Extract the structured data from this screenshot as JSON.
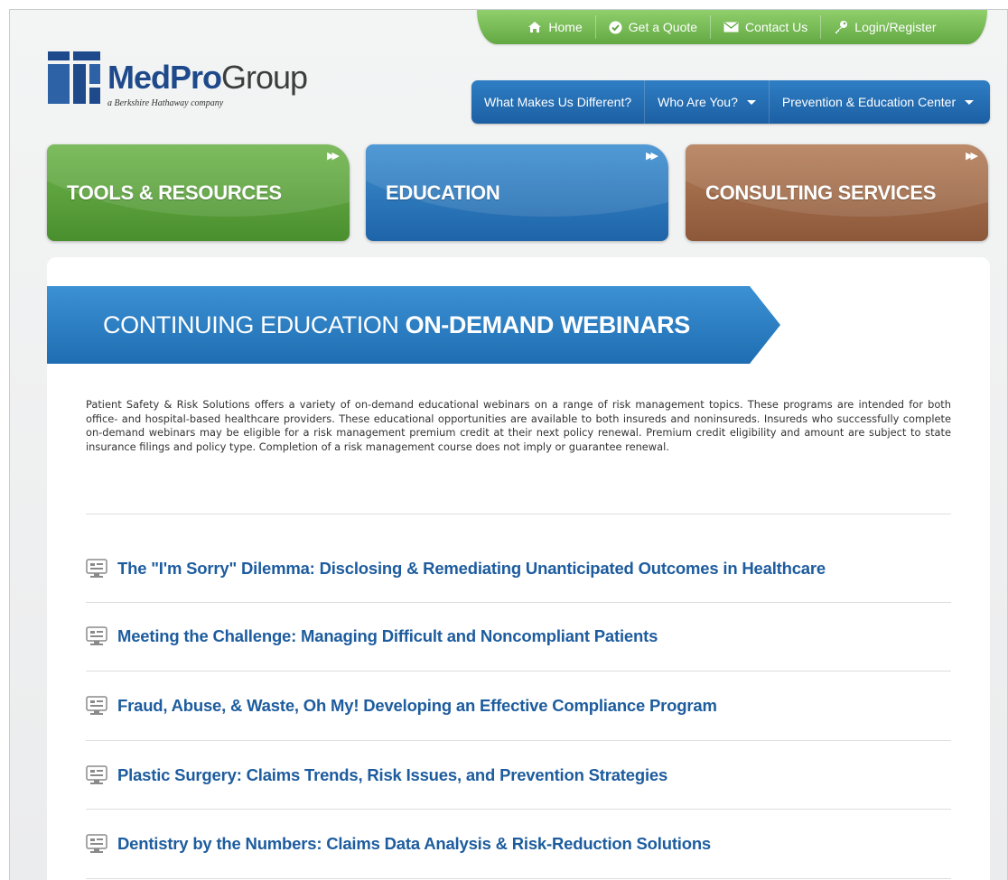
{
  "utility_nav": [
    {
      "label": "Home",
      "icon": "home-icon"
    },
    {
      "label": "Get a Quote",
      "icon": "check-circle-icon"
    },
    {
      "label": "Contact Us",
      "icon": "envelope-icon"
    },
    {
      "label": "Login/Register",
      "icon": "key-icon"
    }
  ],
  "logo": {
    "word_bold": "MedPro",
    "word_light": "Group",
    "tagline": "a Berkshire Hathaway company"
  },
  "main_nav": [
    {
      "label": "What Makes Us Different?"
    },
    {
      "label": "Who Are You?",
      "has_dropdown": true
    },
    {
      "label": "Prevention & Education Center",
      "has_dropdown": true
    }
  ],
  "tiles": [
    {
      "label": "TOOLS & RESOURCES",
      "color": "#5c9f3c"
    },
    {
      "label": "EDUCATION",
      "color": "#2a78bd"
    },
    {
      "label": "CONSULTING SERVICES",
      "color": "#9e6946"
    }
  ],
  "banner": {
    "light": "CONTINUING EDUCATION",
    "bold": "ON-DEMAND WEBINARS"
  },
  "intro": "Patient Safety & Risk Solutions offers a variety of on-demand educational webinars on a range of risk management topics. These programs are intended for both office- and hospital-based healthcare providers. These educational opportunities are available to both insureds and noninsureds. Insureds who successfully complete on-demand webinars may be eligible for a risk management premium credit at their next policy renewal. Premium credit eligibility and amount are subject to state insurance filings and policy type. Completion of a risk management course does not imply or guarantee renewal.",
  "webinars": [
    {
      "title": "The \"I'm Sorry\" Dilemma: Disclosing & Remediating Unanticipated Outcomes in Healthcare",
      "icon": "monitor-icon"
    },
    {
      "title": "Meeting the Challenge: Managing Difficult and Noncompliant Patients",
      "icon": "monitor-icon"
    },
    {
      "title": "Fraud, Abuse, & Waste, Oh My! Developing an Effective Compliance Program",
      "icon": "monitor-icon"
    },
    {
      "title": "Plastic Surgery: Claims Trends, Risk Issues, and Prevention Strategies",
      "icon": "monitor-icon"
    },
    {
      "title": "Dentistry by the Numbers: Claims Data Analysis & Risk-Reduction Solutions",
      "icon": "monitor-icon"
    }
  ],
  "colors": {
    "brand_blue": "#1e4a8c",
    "link_blue": "#1d5c9e",
    "nav_green": "#63a843",
    "nav_blue": "#1c5fa3"
  }
}
